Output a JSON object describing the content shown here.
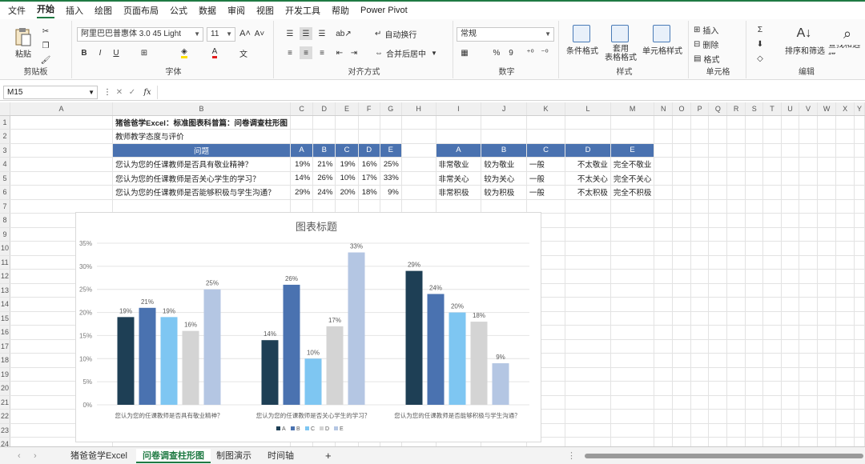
{
  "menu": [
    "文件",
    "开始",
    "插入",
    "绘图",
    "页面布局",
    "公式",
    "数据",
    "审阅",
    "视图",
    "开发工具",
    "帮助",
    "Power Pivot"
  ],
  "ribbon": {
    "paste": "粘贴",
    "clipboard": "剪贴板",
    "font_name": "阿里巴巴普惠体 3.0 45 Light",
    "font_size": "11",
    "font_group": "字体",
    "wrap": "自动换行",
    "merge": "合并后居中",
    "align_group": "对齐方式",
    "num_format": "常规",
    "number_group": "数字",
    "cond_format": "条件格式",
    "table_format": "套用\n表格格式",
    "cell_style": "单元格样式",
    "style_group": "样式",
    "insert": "插入",
    "delete": "删除",
    "format": "格式",
    "cells_group": "单元格",
    "sort_filter": "排序和筛选",
    "find_select": "查找和选择",
    "edit_group": "编辑"
  },
  "formula_bar": {
    "name_box": "M15",
    "fx": "fx"
  },
  "columns": [
    "A",
    "B",
    "C",
    "D",
    "E",
    "F",
    "G",
    "H",
    "I",
    "J",
    "K",
    "L",
    "M",
    "N",
    "O",
    "P",
    "Q",
    "R",
    "S",
    "T",
    "U",
    "V",
    "W",
    "X",
    "Y"
  ],
  "rows": [
    "1",
    "2",
    "3",
    "4",
    "5",
    "6",
    "7",
    "8",
    "9",
    "10",
    "11",
    "12",
    "13",
    "14",
    "15",
    "16",
    "17",
    "18",
    "19",
    "20",
    "21",
    "22",
    "23",
    "24"
  ],
  "sheet": {
    "title": "猪爸爸学Excel：标准图表科普篇：问卷调查柱形图",
    "subtitle": "教师教学态度与评价",
    "left_header": [
      "问题",
      "A",
      "B",
      "C",
      "D",
      "E"
    ],
    "right_header": [
      "A",
      "B",
      "C",
      "D",
      "E"
    ],
    "rows": [
      {
        "q": "您认为您的任课教师是否具有敬业精神？",
        "vals": [
          "19%",
          "21%",
          "19%",
          "16%",
          "25%"
        ],
        "labels": [
          "非常敬业",
          "较为敬业",
          "一般",
          "不太敬业",
          "完全不敬业"
        ]
      },
      {
        "q": "您认为您的任课教师是否关心学生的学习？",
        "vals": [
          "14%",
          "26%",
          "10%",
          "17%",
          "33%"
        ],
        "labels": [
          "非常关心",
          "较为关心",
          "一般",
          "不太关心",
          "完全不关心"
        ]
      },
      {
        "q": "您认为您的任课教师是否能够积极与学生沟通？",
        "vals": [
          "29%",
          "24%",
          "20%",
          "18%",
          "9%"
        ],
        "labels": [
          "非常积极",
          "较为积极",
          "一般",
          "不太积极",
          "完全不积极"
        ]
      }
    ]
  },
  "chart_data": {
    "type": "bar",
    "title": "图表标题",
    "categories": [
      "您认为您的任课教师是否具有敬业精神？",
      "您认为您的任课教师是否关心学生的学习？",
      "您认为您的任课教师是否能够积极与学生沟通？"
    ],
    "series": [
      {
        "name": "A",
        "values": [
          19,
          14,
          29
        ],
        "labels": [
          "19%",
          "14%",
          "29%"
        ],
        "color": "#1e3f55"
      },
      {
        "name": "B",
        "values": [
          21,
          26,
          24
        ],
        "labels": [
          "21%",
          "26%",
          "24%"
        ],
        "color": "#4a72b0"
      },
      {
        "name": "C",
        "values": [
          19,
          10,
          20
        ],
        "labels": [
          "19%",
          "10%",
          "20%"
        ],
        "color": "#7ec6f2"
      },
      {
        "name": "D",
        "values": [
          16,
          17,
          18
        ],
        "labels": [
          "16%",
          "17%",
          "18%"
        ],
        "color": "#d4d4d4"
      },
      {
        "name": "E",
        "values": [
          25,
          33,
          9
        ],
        "labels": [
          "25%",
          "33%",
          "9%"
        ],
        "color": "#b4c6e3"
      }
    ],
    "yticks": [
      "0%",
      "5%",
      "10%",
      "15%",
      "20%",
      "25%",
      "30%",
      "35%"
    ],
    "ylim": [
      0,
      35
    ],
    "grid": true,
    "legend": "bottom"
  },
  "tabs": [
    "猪爸爸学Excel",
    "问卷调查柱形图",
    "制图演示",
    "时间轴"
  ],
  "active_tab": "问卷调查柱形图",
  "add_tab": "+"
}
